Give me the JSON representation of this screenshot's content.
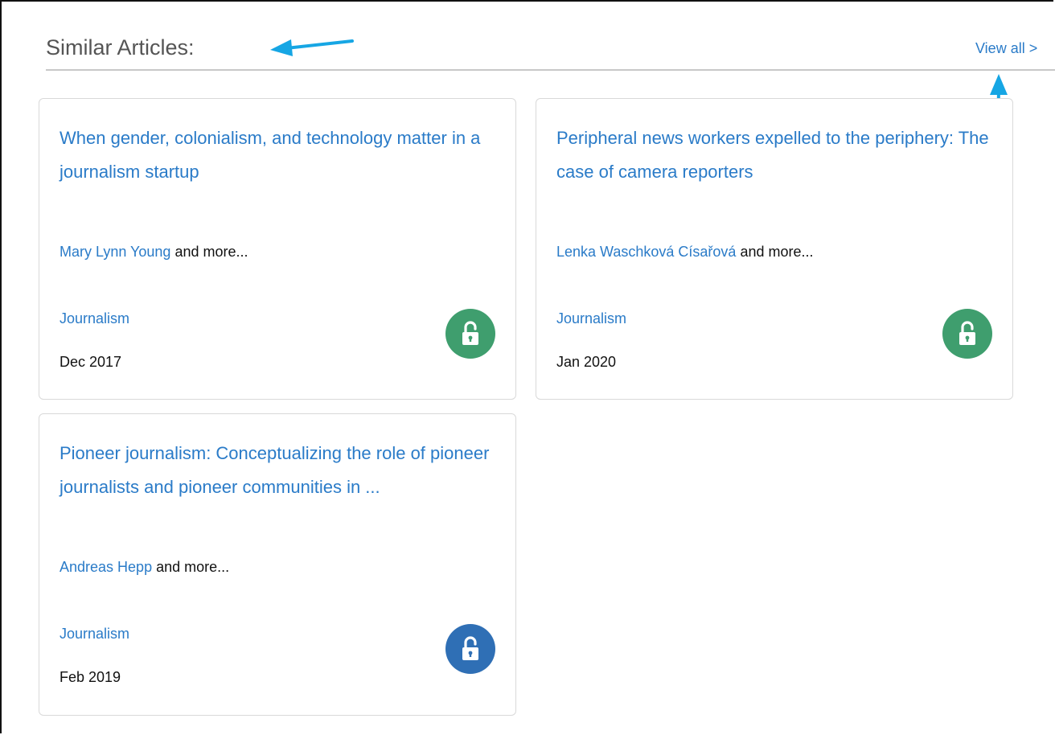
{
  "section": {
    "title": "Similar Articles:",
    "view_all_label": "View all >"
  },
  "colors": {
    "link": "#2a7bc8",
    "open_access_green": "#3f9e6e",
    "open_access_blue": "#2f6fb5",
    "annotation_arrow": "#16a6e4"
  },
  "articles": [
    {
      "title": "When gender, colonialism, and technology matter in a journalism startup",
      "author": "Mary Lynn Young",
      "author_suffix": " and more...",
      "journal": "Journalism",
      "date": "Dec 2017",
      "access_icon": "unlock-icon",
      "access_color": "#3f9e6e"
    },
    {
      "title": "Peripheral news workers expelled to the periphery: The case of camera reporters",
      "author": "Lenka Waschková Císařová",
      "author_suffix": " and more...",
      "journal": "Journalism",
      "date": "Jan 2020",
      "access_icon": "unlock-icon",
      "access_color": "#3f9e6e"
    },
    {
      "title": "Pioneer journalism: Conceptualizing the role of pioneer journalists and pioneer communities in ...",
      "author": "Andreas Hepp",
      "author_suffix": " and more...",
      "journal": "Journalism",
      "date": "Feb 2019",
      "access_icon": "unlock-icon",
      "access_color": "#2f6fb5"
    }
  ]
}
